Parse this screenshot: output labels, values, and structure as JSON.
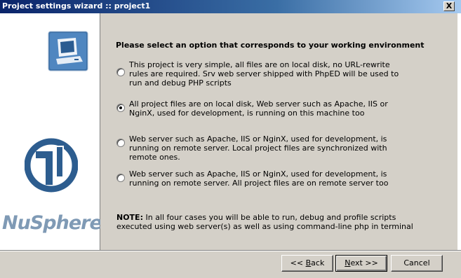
{
  "window": {
    "title": "Project settings wizard :: project1",
    "close_glyph": "X"
  },
  "sidebar": {
    "brand": "NuSphere"
  },
  "main": {
    "heading": "Please select an option that corresponds to your working environment",
    "options": [
      {
        "label": "This project is very simple, all files are on local disk, no URL-rewrite rules are required. Srv web server shipped with PhpED will be used to run and debug PHP scripts",
        "checked": false
      },
      {
        "label": "All project files are on local disk, Web server such as Apache, IIS or NginX, used for development, is running on this machine too",
        "checked": true
      },
      {
        "label": "Web server such as Apache, IIS or NginX, used for development, is running on remote server. Local project files are synchronized with remote ones.",
        "checked": false
      },
      {
        "label": "Web server such as Apache, IIS or NginX, used for development, is running on remote server. All project files are on remote server too",
        "checked": false
      }
    ],
    "note_label": "NOTE:",
    "note_text": " In all four cases you will be able to run, debug and profile scripts executed using web server(s) as well as using command-line php in terminal"
  },
  "buttons": {
    "back_prefix": "<< ",
    "back_hotkey": "B",
    "back_rest": "ack",
    "next_hotkey": "N",
    "next_rest": "ext >>",
    "cancel": "Cancel"
  }
}
